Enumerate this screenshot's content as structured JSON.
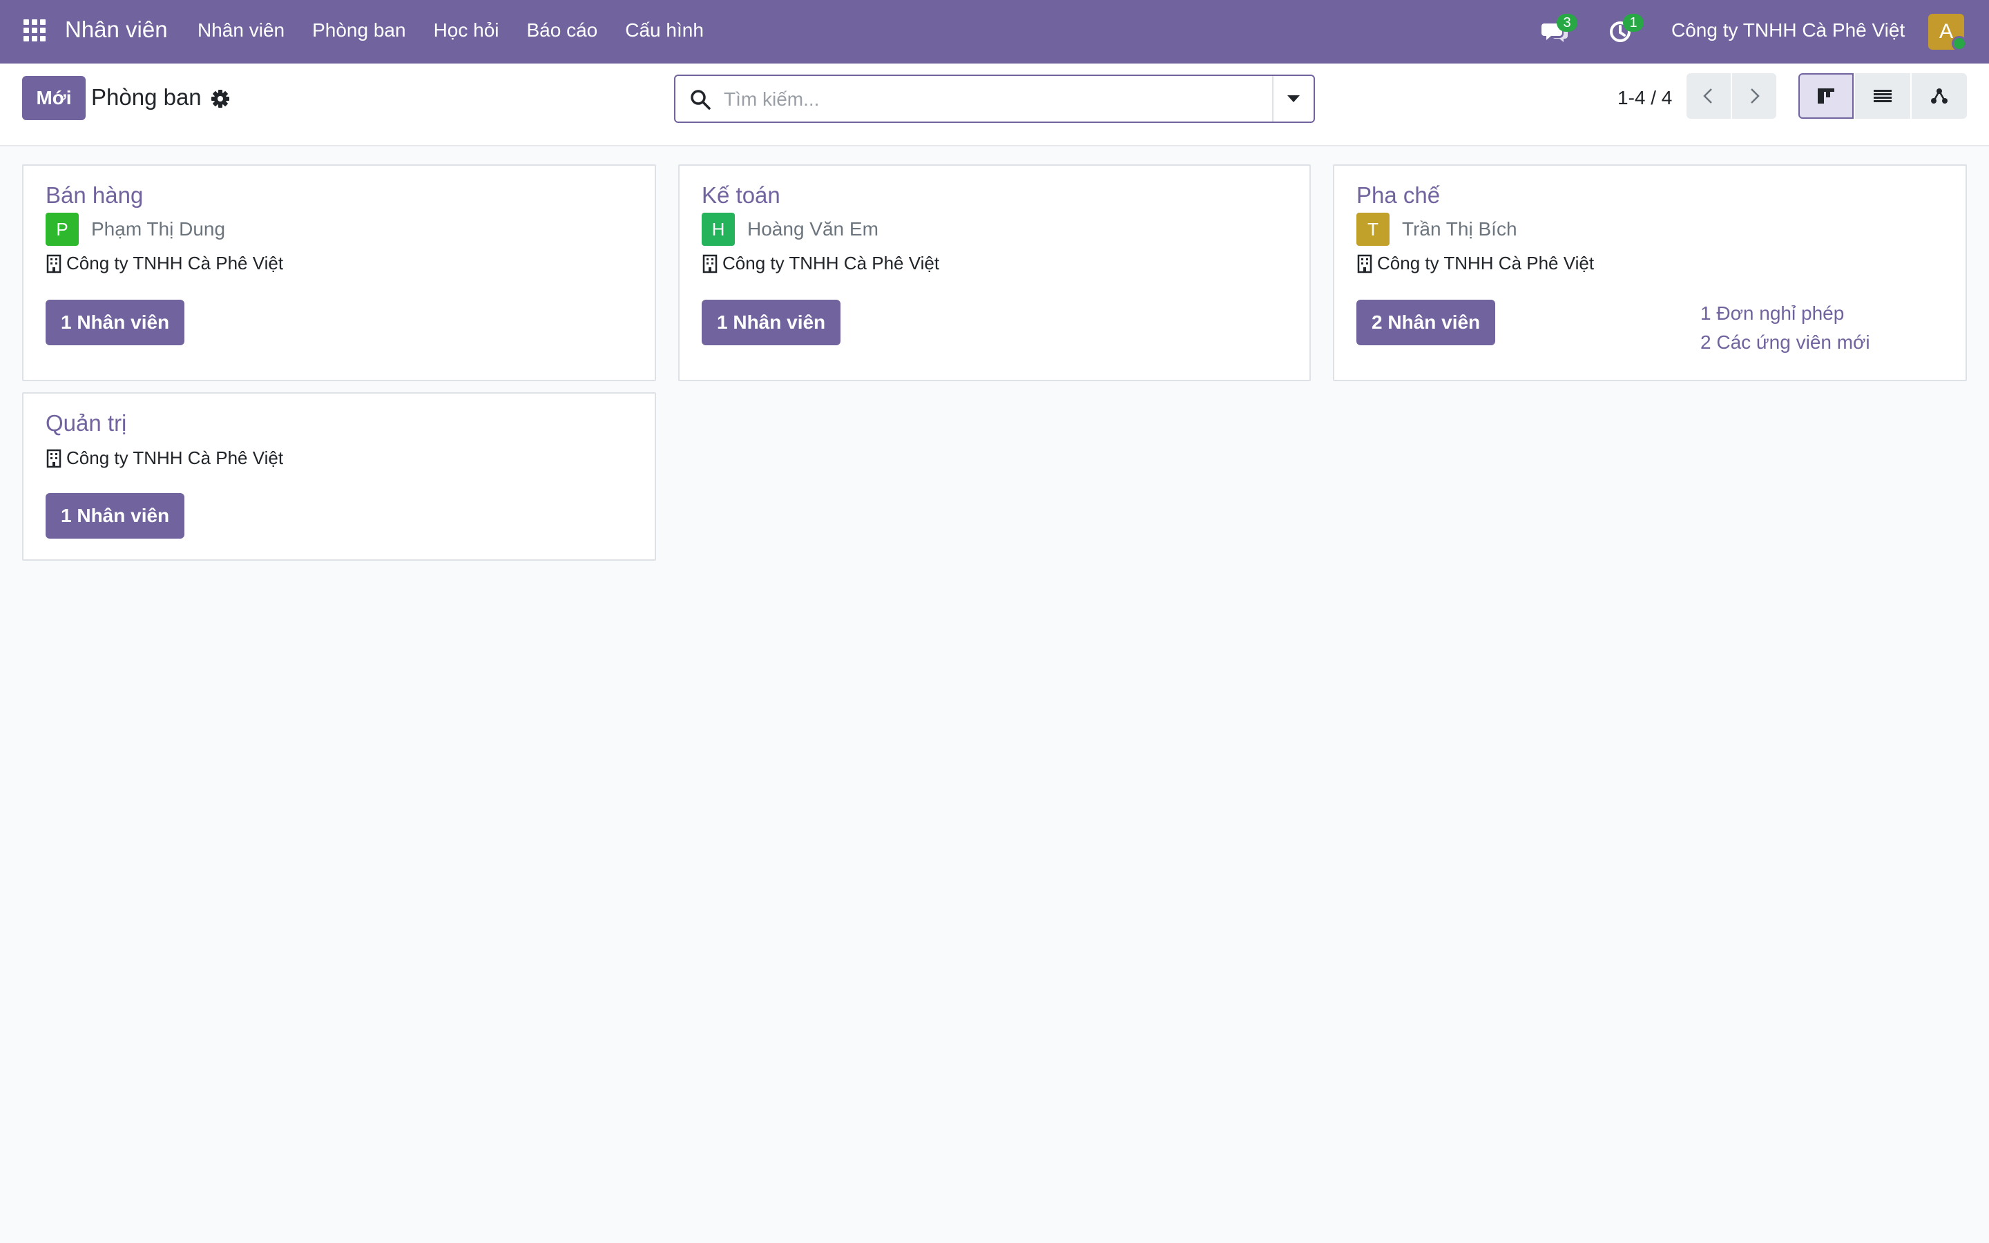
{
  "navbar": {
    "app_name": "Nhân viên",
    "menu": [
      "Nhân viên",
      "Phòng ban",
      "Học hỏi",
      "Báo cáo",
      "Cấu hình"
    ],
    "chat_badge": "3",
    "activity_badge": "1",
    "company": "Công ty TNHH Cà Phê Việt",
    "avatar_letter": "A",
    "accent_color": "#71639e"
  },
  "control_panel": {
    "new_label": "Mới",
    "title": "Phòng ban",
    "search_placeholder": "Tìm kiếm...",
    "pager": "1-4 / 4",
    "views": [
      "kanban-icon",
      "list-icon",
      "hierarchy-icon"
    ],
    "active_view": "kanban-icon"
  },
  "departments": [
    {
      "name": "Bán hàng",
      "manager_initial": "P",
      "manager_name": "Phạm Thị Dung",
      "manager_color": "#2eb82e",
      "company": "Công ty TNHH Cà Phê Việt",
      "employees_label": "1 Nhân viên",
      "links": []
    },
    {
      "name": "Kế toán",
      "manager_initial": "H",
      "manager_name": "Hoàng Văn Em",
      "manager_color": "#24b35a",
      "company": "Công ty TNHH Cà Phê Việt",
      "employees_label": "1 Nhân viên",
      "links": []
    },
    {
      "name": "Pha chế",
      "manager_initial": "T",
      "manager_name": "Trần Thị Bích",
      "manager_color": "#c2a12a",
      "company": "Công ty TNHH Cà Phê Việt",
      "employees_label": "2 Nhân viên",
      "links": [
        "1 Đơn nghỉ phép",
        "2 Các ứng viên mới"
      ]
    },
    {
      "name": "Quản trị",
      "company": "Công ty TNHH Cà Phê Việt",
      "employees_label": "1 Nhân viên",
      "links": []
    }
  ]
}
